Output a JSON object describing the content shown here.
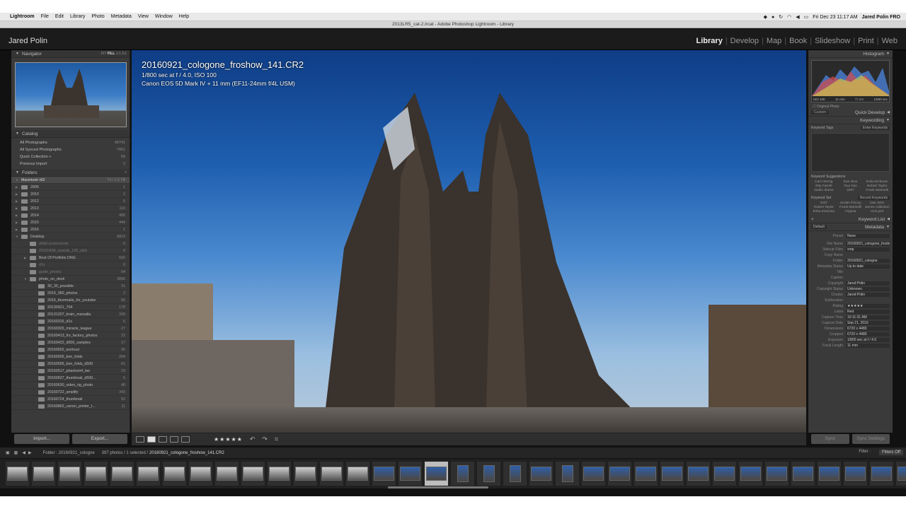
{
  "menubar": {
    "items": [
      "Lightroom",
      "File",
      "Edit",
      "Library",
      "Photo",
      "Metadata",
      "View",
      "Window",
      "Help"
    ],
    "clock": "Fri Dec 23  11:17 AM",
    "user": "Jared Polin FRO"
  },
  "window": {
    "title": "2013LR5_cat-2.lrcat - Adobe Photoshop Lightroom - Library"
  },
  "identity": {
    "name": "Jared Polin"
  },
  "modules": [
    {
      "label": "Library",
      "active": true
    },
    {
      "label": "Develop"
    },
    {
      "label": "Map"
    },
    {
      "label": "Book"
    },
    {
      "label": "Slideshow"
    },
    {
      "label": "Print"
    },
    {
      "label": "Web"
    }
  ],
  "navigator": {
    "title": "Navigator",
    "zoom": [
      "FIT",
      "FILL",
      "1:1",
      "3:1"
    ]
  },
  "catalog": {
    "title": "Catalog",
    "items": [
      {
        "label": "All Photographs",
        "count": "48741"
      },
      {
        "label": "All Synced Photographs",
        "count": "7461"
      },
      {
        "label": "Quick Collection +",
        "count": "58"
      },
      {
        "label": "Previous Import",
        "count": "2"
      }
    ]
  },
  "folders": {
    "title": "Folders",
    "volume": {
      "label": "Macintosh HD",
      "count": "73 / 1.0 TB"
    },
    "items": [
      {
        "label": "2005",
        "count": "1"
      },
      {
        "label": "2010",
        "count": "2"
      },
      {
        "label": "2012",
        "count": "6"
      },
      {
        "label": "2013",
        "count": "110"
      },
      {
        "label": "2014",
        "count": "495"
      },
      {
        "label": "2015",
        "count": "444"
      },
      {
        "label": "2016",
        "count": "1"
      },
      {
        "label": "Desktop",
        "count": "6813"
      },
      {
        "label": "dddd screenshots",
        "count": "0"
      },
      {
        "label": "20160408_rawtalk_128_stills",
        "count": "0"
      },
      {
        "label": "Best Of Portfolio DNG",
        "count": "592"
      },
      {
        "label": "d1x",
        "count": "0"
      },
      {
        "label": "guide_photos",
        "count": "54"
      },
      {
        "label": "photo_on_desk",
        "count": "3896"
      },
      {
        "label": "30_30_possible",
        "count": "31"
      },
      {
        "label": "2016_360_photos",
        "count": "2"
      },
      {
        "label": "2016_thumnails_for_youtube",
        "count": "66"
      },
      {
        "label": "20130921_704",
        "count": "178"
      },
      {
        "label": "20131207_brain_marsalla",
        "count": "339"
      },
      {
        "label": "20160316_d1x",
        "count": "6"
      },
      {
        "label": "20160326_miracle_league",
        "count": "27"
      },
      {
        "label": "20160413_fro_factory_photos",
        "count": "22"
      },
      {
        "label": "20160422_d500_samples",
        "count": "17"
      },
      {
        "label": "20160502_workout",
        "count": "95"
      },
      {
        "label": "20160506_ben_folds",
        "count": "264"
      },
      {
        "label": "20160506_ben_folds_d500",
        "count": "61"
      },
      {
        "label": "20160517_phantom4_twr",
        "count": "19"
      },
      {
        "label": "20160627_thumbnail_d500...",
        "count": "5"
      },
      {
        "label": "20160630_video_rig_photo",
        "count": "46"
      },
      {
        "label": "20160722_amplify",
        "count": "343"
      },
      {
        "label": "20160724_thumbnail",
        "count": "52"
      },
      {
        "label": "20160802_canon_printer_t...",
        "count": "11"
      }
    ]
  },
  "left_buttons": {
    "import": "Import...",
    "export": "Export..."
  },
  "photo_info": {
    "filename": "20160921_cologone_froshow_141.CR2",
    "exposure": "1/800 sec at f / 4.0, ISO 100",
    "camera": "Canon EOS 5D Mark IV + 11 mm (EF11-24mm f/4L USM)"
  },
  "histogram": {
    "title": "Histogram",
    "labels": [
      "ISO 100",
      "11 mm",
      "f / 4.0",
      "1/800 sec"
    ],
    "original_photo": "Original Photo"
  },
  "quick_develop": {
    "preset": "Custom",
    "title": "Quick Develop"
  },
  "keywording": {
    "title": "Keywording",
    "tags_label": "Keyword Tags",
    "tags_placeholder": "Enter Keywords",
    "suggestions_label": "Keyword Suggestions",
    "suggestions": [
      "Carl Hertzig",
      "Dan Woo",
      "Erika Eickman",
      "Etty Farrell",
      "Tour bus",
      "Robert Taylor",
      "studio drums",
      "2007",
      "Frank Marinelli"
    ],
    "set_label": "Keyword Set",
    "set_value": "Recent Keywords",
    "set_items": [
      "2007",
      "Jordan Pincey",
      "Dan Woo",
      "Robert Taylor",
      "Frank Marinelli",
      "James Addiction",
      "Erika Eickman",
      "Virginia",
      "rock perl"
    ]
  },
  "keyword_list": {
    "title": "Keyword List"
  },
  "metadata": {
    "preset_view": "Default",
    "title": "Metadata",
    "preset_label": "Preset",
    "preset_value": "None",
    "fields": [
      {
        "k": "File Name",
        "v": "20160921_cologone_froshow_141.CR2"
      },
      {
        "k": "Sidecar Files",
        "v": "xmp"
      },
      {
        "k": "Copy Name",
        "v": ""
      },
      {
        "k": "Folder",
        "v": "20160921_cologne"
      },
      {
        "k": "Metadata Status",
        "v": "Up to date"
      },
      {
        "k": "Title",
        "v": ""
      },
      {
        "k": "Caption",
        "v": ""
      },
      {
        "k": "Copyright",
        "v": "Jared Polin"
      },
      {
        "k": "Copyright Status",
        "v": "Unknown"
      },
      {
        "k": "Creator",
        "v": "Jared Polin"
      },
      {
        "k": "Sublocation",
        "v": ""
      },
      {
        "k": "Rating",
        "v": "★★★★★"
      },
      {
        "k": "Label",
        "v": "Red"
      },
      {
        "k": "Capture Time",
        "v": "10:11:31 AM"
      },
      {
        "k": "Capture Date",
        "v": "Sep 21, 2016"
      },
      {
        "k": "Dimensions",
        "v": "6720 x 4480"
      },
      {
        "k": "Cropped",
        "v": "6720 x 4480"
      },
      {
        "k": "Exposure",
        "v": "1/800 sec at f / 4.0"
      },
      {
        "k": "Focal Length",
        "v": "11 mm"
      }
    ]
  },
  "right_buttons": {
    "sync": "Sync",
    "sync_settings": "Sync Settings"
  },
  "toolbar": {
    "rating": "★★★★★"
  },
  "filmstrip_bar": {
    "source": "Folder : 20160921_cologne",
    "count": "397 photos / 1 selected /",
    "selected": "20160921_cologone_froshow_141.CR2",
    "filter_label": "Filter :",
    "filter_value": "Filters Off"
  },
  "colors": {
    "accent": "#eeeeee",
    "panel": "#3a3a3a",
    "background": "#111111"
  }
}
